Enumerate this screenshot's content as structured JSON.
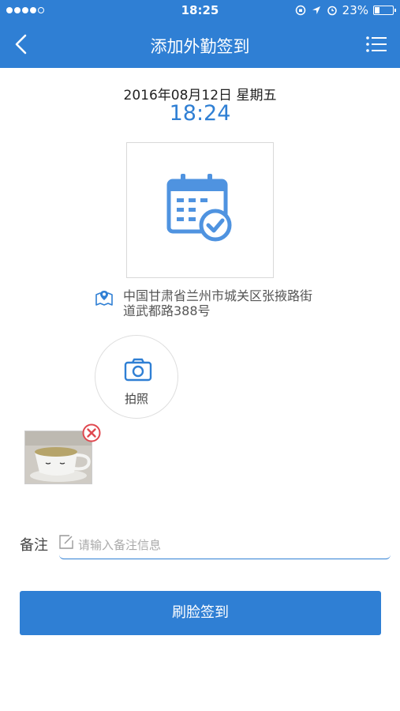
{
  "status_bar": {
    "time": "18:25",
    "battery": "23%",
    "battery_level": 0.23
  },
  "nav": {
    "title": "添加外勤签到",
    "back_icon": "chevron-left-icon",
    "menu_icon": "list-menu-icon"
  },
  "checkin": {
    "date": "2016年08月12日 星期五",
    "time": "18:24",
    "photo_placeholder_icon": "calendar-check-icon"
  },
  "location": {
    "icon": "map-pin-icon",
    "address": "中国甘肃省兰州市城关区张掖路街道武都路388号"
  },
  "camera": {
    "icon": "camera-icon",
    "label": "拍照"
  },
  "attachment": {
    "remove_icon": "remove-circle-icon"
  },
  "note": {
    "label": "备注",
    "placeholder": "请输入备注信息",
    "value": ""
  },
  "submit": {
    "label": "刷脸签到"
  },
  "colors": {
    "primary": "#2f7fd4",
    "danger": "#e0484f",
    "icon_light": "#4f93e0"
  }
}
